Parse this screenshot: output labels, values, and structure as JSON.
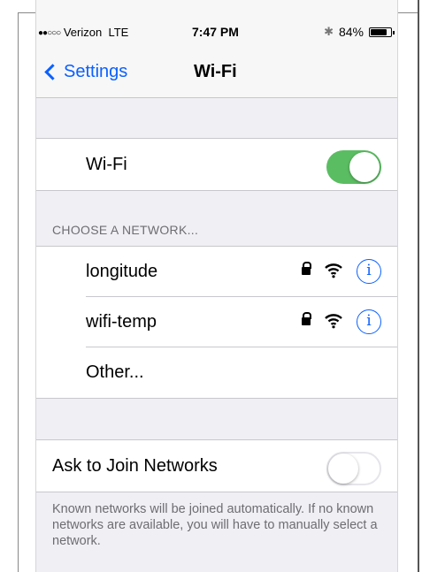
{
  "status_bar": {
    "signal_dots": "●●○○○",
    "carrier": "Verizon",
    "network": "LTE",
    "time": "7:47 PM",
    "bluetooth": "✱",
    "battery_text": "84%",
    "battery_level": 0.84
  },
  "nav": {
    "back_label": "Settings",
    "title": "Wi-Fi"
  },
  "wifi_toggle": {
    "label": "Wi-Fi",
    "on": true
  },
  "networks_section": {
    "header": "CHOOSE A NETWORK...",
    "networks": [
      {
        "name": "longitude",
        "secured": true,
        "icons": [
          "lock-icon",
          "wifi-icon",
          "info-icon"
        ]
      },
      {
        "name": "wifi-temp",
        "secured": true,
        "icons": [
          "lock-icon",
          "wifi-icon",
          "info-icon"
        ]
      }
    ],
    "other_label": "Other..."
  },
  "ask_to_join": {
    "label": "Ask to Join Networks",
    "on": false,
    "footer": "Known networks will be joined automatically. If no known networks are available, you will have to manually select a network."
  },
  "colors": {
    "accent": "#0a60ff",
    "toggle_on": "#5bbd62",
    "background": "#efeff4"
  }
}
